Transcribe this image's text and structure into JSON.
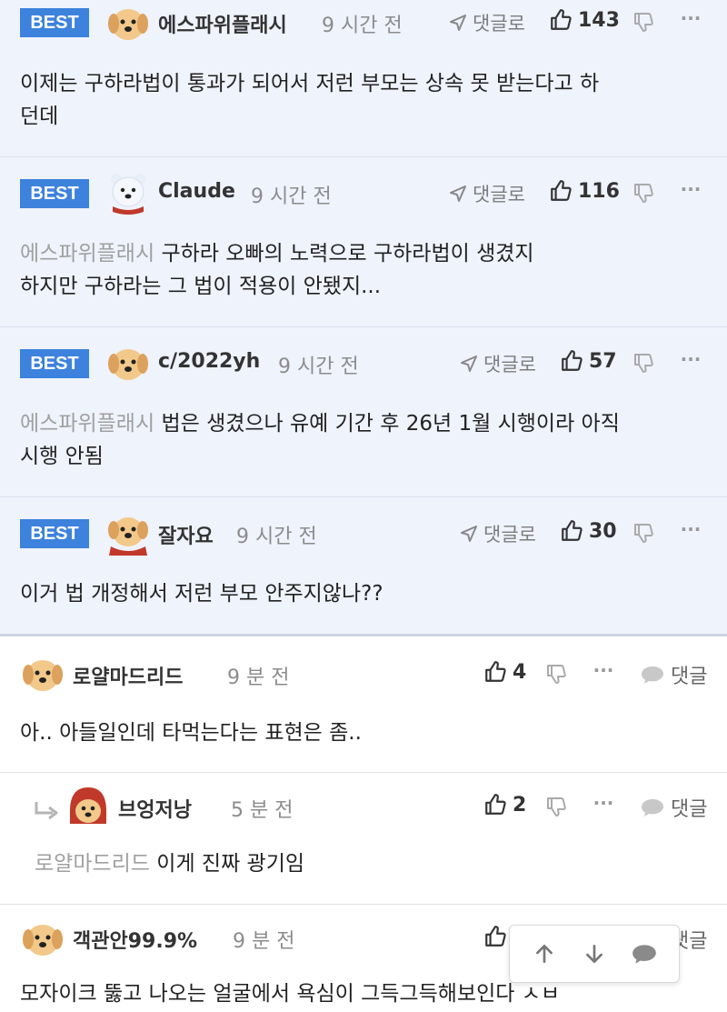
{
  "best_label": "BEST",
  "reply_link_label": "댓글로",
  "reply_label": "댓글",
  "more_label": "···",
  "best_comments": [
    {
      "user": "에스파위플래시",
      "time": "9 시간 전",
      "likes": "143",
      "mention": "",
      "text1": "이제는 구하라법이 통과가 되어서 저런 부모는 상속 못 받는다고 하",
      "text2": "던데"
    },
    {
      "user": "Claude",
      "time": "9 시간 전",
      "likes": "116",
      "mention": "에스파위플래시",
      "text1": "구하라 오빠의 노력으로 구하라법이 생겼지",
      "text2": "하지만 구하라는 그 법이 적용이 안됐지..."
    },
    {
      "user": "c/2022yh",
      "time": "9 시간 전",
      "likes": "57",
      "mention": "에스파위플래시",
      "text1": "법은 생겼으나 유예 기간 후 26년 1월 시행이라 아직",
      "text2": "시행 안됨"
    },
    {
      "user": "잘자요",
      "time": "9 시간 전",
      "likes": "30",
      "mention": "",
      "text1": "이거 법 개정해서 저런 부모 안주지않나??",
      "text2": ""
    }
  ],
  "comments": [
    {
      "user": "로얄마드리드",
      "time": "9 분 전",
      "likes": "4",
      "mention": "",
      "text": "아.. 아들일인데 타먹는다는 표현은 좀.."
    },
    {
      "user": "브엉저낭",
      "time": "5 분 전",
      "likes": "2",
      "mention": "로얄마드리드",
      "text": "이게 진짜 광기임"
    },
    {
      "user": "객관안99.9%",
      "time": "9 분 전",
      "likes": "",
      "mention": "",
      "text": "모자이크 뚫고 나오는 얼굴에서 욕심이 그득그득해보인다 ㅅㅂ"
    }
  ],
  "colors": {
    "best_badge": "#3d82dc",
    "best_bg": "#eef3fc",
    "muted": "#8c8c8c"
  }
}
